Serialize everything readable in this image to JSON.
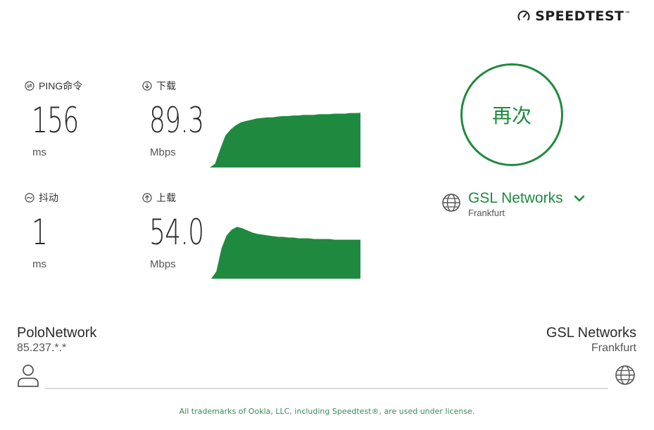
{
  "header": {
    "logo_text": "SPEEDTEST",
    "logo_icon": "gauge-icon",
    "trademark": "™"
  },
  "metrics": {
    "ping": {
      "label": "PING命令",
      "value": "156",
      "unit": "ms",
      "icon": "ping-icon"
    },
    "jitter": {
      "label": "抖动",
      "value": "1",
      "unit": "ms",
      "icon": "jitter-icon"
    },
    "download": {
      "label": "下载",
      "value": "89.3",
      "unit": "Mbps",
      "icon": "download-arrow-icon"
    },
    "upload": {
      "label": "上载",
      "value": "54.0",
      "unit": "Mbps",
      "icon": "upload-arrow-icon"
    }
  },
  "chart_data": [
    {
      "type": "area",
      "xlabel": "",
      "ylabel": "",
      "series": [
        {
          "values": [
            0,
            6,
            30,
            52,
            62,
            69,
            74,
            76,
            78,
            80,
            81,
            82,
            82,
            83,
            84,
            84,
            85,
            85,
            86,
            86,
            86,
            87,
            87,
            87,
            88,
            88,
            88,
            89,
            89,
            89.3
          ]
        }
      ]
    },
    {
      "type": "area",
      "xlabel": "",
      "ylabel": "",
      "series": [
        {
          "values": [
            0,
            10,
            42,
            60,
            68,
            72,
            70,
            67,
            64,
            62,
            61,
            60,
            59,
            58,
            58,
            57,
            57,
            56,
            56,
            56,
            55,
            55,
            55,
            55,
            54,
            54,
            54,
            54,
            54,
            54.0
          ]
        }
      ]
    }
  ],
  "again_button": {
    "label": "再次"
  },
  "server_select": {
    "name": "GSL Networks",
    "location": "Frankfurt",
    "icon": "globe-icon",
    "toggle_icon": "chevron-down-icon"
  },
  "connection": {
    "isp_name": "PoloNetwork",
    "isp_ip": "85.237.*.*",
    "host_name": "GSL Networks",
    "host_location": "Frankfurt",
    "user_icon": "user-icon",
    "host_icon": "globe-icon"
  },
  "footer": {
    "legal": "All trademarks of Ookla, LLC, including Speedtest®, are used under license."
  },
  "colors": {
    "accent": "#1f8a3f",
    "text": "#333333"
  }
}
